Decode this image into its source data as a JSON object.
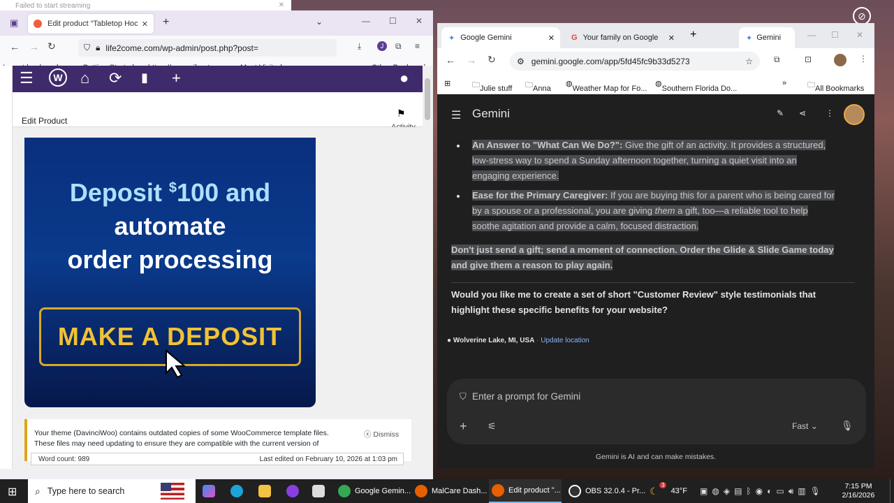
{
  "bg_window": {
    "title": "Failed to start streaming"
  },
  "firefox": {
    "tab_title": "Edit product “Tabletop Hockey ",
    "url": "life2come.com/wp-admin/post.php?post=",
    "bookmarks": [
      "Import bookmarks...",
      "Getting Started",
      "https://www.silverts.co...",
      "Most Visited",
      "Other Bookmarks"
    ],
    "wp": {
      "page_title": "Edit Product",
      "activity_label": "Activity",
      "banner": {
        "line1": "Deposit",
        "currency": "$",
        "line1b": "100 and",
        "line2": "automate",
        "line3": "order processing",
        "button": "MAKE A DEPOSIT"
      },
      "notice": {
        "text": "Your theme (DavinciWoo) contains outdated copies of some WooCommerce template files.",
        "text2": "These files may need updating to ensure they are compatible with the current version of",
        "dismiss": "Dismiss"
      },
      "word_count": "Word count: 989",
      "last_edited": "Last edited on February 10, 2026 at 1:03 pm"
    }
  },
  "chrome": {
    "tabs": [
      {
        "label": "Google Gemini"
      },
      {
        "label": "Your family on Google"
      },
      {
        "label": "Gemini"
      }
    ],
    "url": "gemini.google.com/app/5fd45fc9b33d5273",
    "bookmarks": [
      "Julie stuff",
      "Anna",
      "Weather Map for Fo...",
      "Southern Florida Do...",
      "All Bookmarks"
    ],
    "gemini": {
      "title": "Gemini",
      "b1_bold": "An Answer to \"What Can We Do?\":",
      "b1_l1": " Give the gift of an activity. It provides a structured,",
      "b1_l2": "low-stress way to spend a Sunday afternoon together, turning a quiet visit into an",
      "b1_l3": "engaging experience.",
      "b2_bold": "Ease for the Primary Caregiver:",
      "b2_l1": " If you are buying this for a parent who is being cared for",
      "b2_l2a": "by a spouse or a professional, you are giving ",
      "b2_l2em": "them",
      "b2_l2b": " a gift, too—a reliable tool to help",
      "b2_l3": "soothe agitation and provide a calm, focused distraction.",
      "cta_l1": "Don't just send a gift; send a moment of connection. Order the Glide & Slide Game today",
      "cta_l2": "and give them a reason to play again.",
      "question_l1": "Would you like me to create a set of short \"Customer Review\" style testimonials that",
      "question_l2": "highlight these specific benefits for your website?",
      "location": "Wolverine Lake, MI, USA",
      "update_location": "Update location",
      "prompt_placeholder": "Enter a prompt for Gemini",
      "mode": "Fast",
      "disclaimer": "Gemini is AI and can make mistakes."
    }
  },
  "taskbar": {
    "search_placeholder": "Type here to search",
    "apps": [
      "Google Gemin...",
      "MalCare Dash...",
      "Edit product \"...",
      "OBS 32.0.4 - Pr..."
    ],
    "weather_badge": "3",
    "temperature": "43°F",
    "time": "7:15 PM",
    "date": "2/16/2026"
  },
  "colors": {
    "wp_admin_bar": "#3f2a6b",
    "banner_gold": "#f1c234",
    "gemini_bg": "#1f1f1f",
    "selection": "#494b4f"
  }
}
